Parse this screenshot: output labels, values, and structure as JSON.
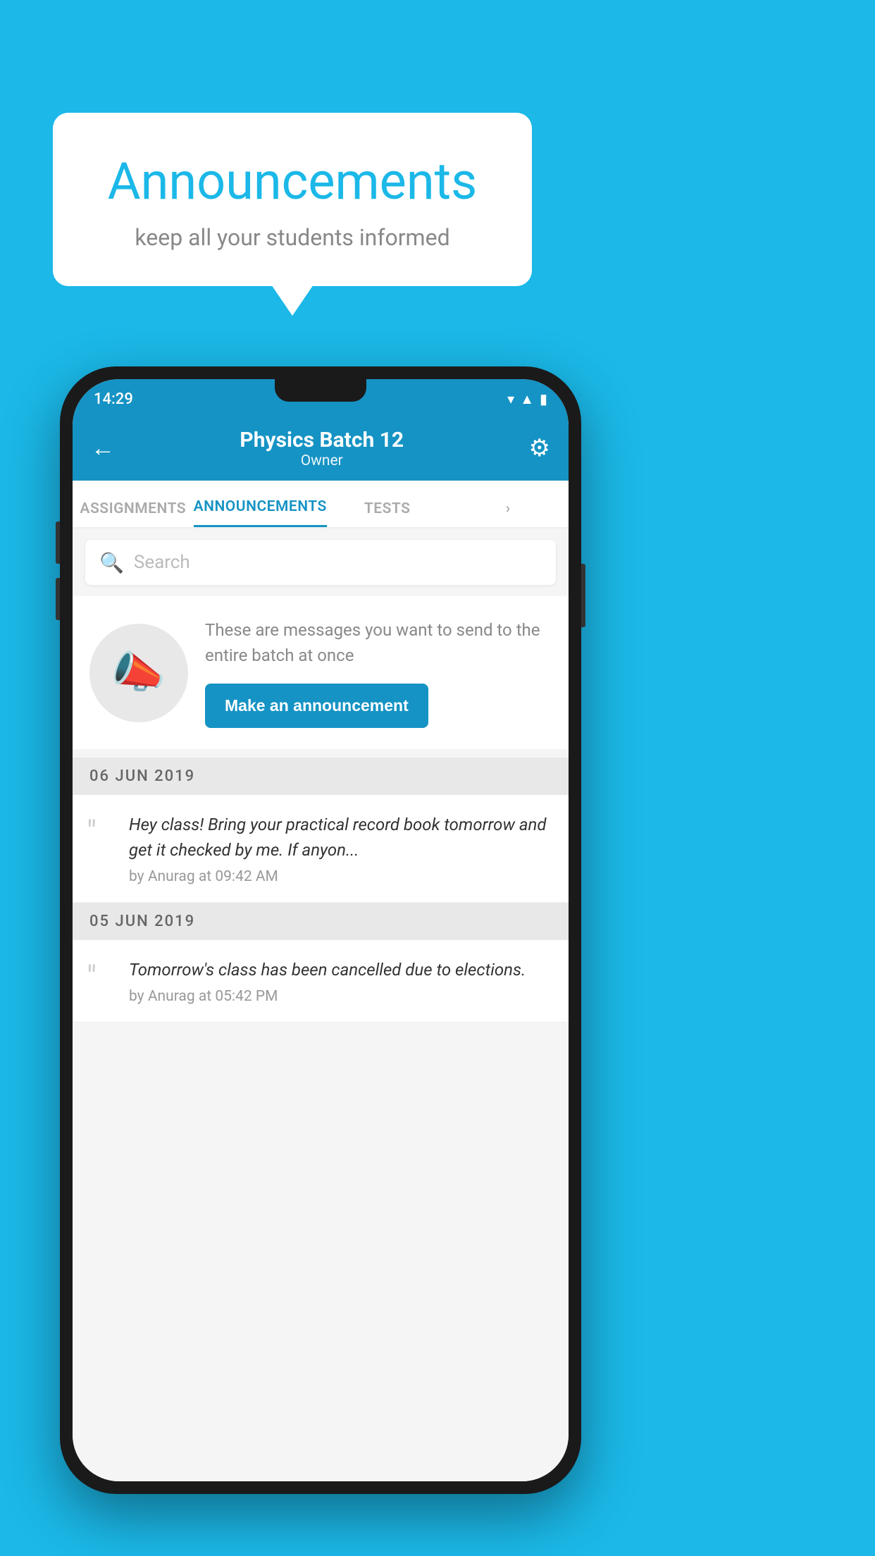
{
  "bubble": {
    "title": "Announcements",
    "subtitle": "keep all your students informed"
  },
  "phone": {
    "status_bar": {
      "time": "14:29"
    },
    "app_bar": {
      "title": "Physics Batch 12",
      "subtitle": "Owner",
      "back_icon": "←",
      "gear_icon": "⚙"
    },
    "tabs": [
      {
        "label": "ASSIGNMENTS",
        "active": false
      },
      {
        "label": "ANNOUNCEMENTS",
        "active": true
      },
      {
        "label": "TESTS",
        "active": false
      },
      {
        "label": "›",
        "active": false
      }
    ],
    "search": {
      "placeholder": "Search"
    },
    "prompt": {
      "description": "These are messages you want to send to the entire batch at once",
      "button_label": "Make an announcement"
    },
    "announcements": [
      {
        "date": "06  JUN  2019",
        "body": "Hey class! Bring your practical record book tomorrow and get it checked by me. If anyon...",
        "meta": "by Anurag at 09:42 AM"
      },
      {
        "date": "05  JUN  2019",
        "body": "Tomorrow's class has been cancelled due to elections.",
        "meta": "by Anurag at 05:42 PM"
      }
    ]
  }
}
